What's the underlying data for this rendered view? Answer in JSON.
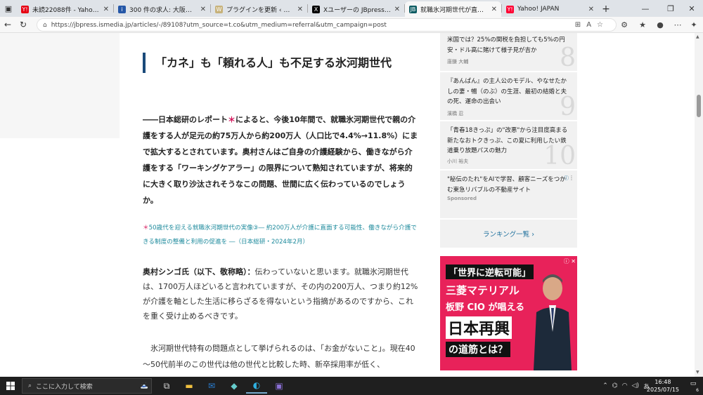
{
  "tabs": [
    {
      "title": "未読22088件 - Yahoo!メール",
      "favicon": "Y!",
      "fav_color": "#e60012",
      "active": false
    },
    {
      "title": "300 件の求人: 大阪府 大阪市",
      "favicon": "i",
      "fav_color": "#2557a7",
      "active": false
    },
    {
      "title": "プラグインを更新 ‹ よしてよせてのの",
      "favicon": "W",
      "fav_color": "#c7b27a",
      "active": false
    },
    {
      "title": "Xユーザーの JBpress（ジェイビー）",
      "favicon": "X",
      "fav_color": "#000000",
      "active": false
    },
    {
      "title": "就職氷河期世代が直面する介",
      "favicon": "JB",
      "fav_color": "#0d5c63",
      "active": true
    },
    {
      "title": "Yahoo! JAPAN",
      "favicon": "Y!",
      "fav_color": "#ff0033",
      "active": false
    }
  ],
  "address_bar": {
    "url": "https://jbpress.ismedia.jp/articles/-/89108?utm_source=t.co&utm_medium=referral&utm_campaign=post"
  },
  "article": {
    "heading": "「カネ」も「頼れる人」も不足する氷河期世代",
    "lead_pre": "――日本総研のレポート",
    "lead_mark": "＊",
    "lead_post": "によると、今後10年間で、就職氷河期世代で親の介護をする人が足元の約75万人から約200万人（人口比で4.4%→11.8%）にまで拡大するとされています。奥村さんはご自身の介護経験から、働きながら介護をする「ワーキングケアラー」の限界について熟知されていますが、将来的に大きく取り沙汰されそうなこの問題、世間に広く伝わっているのでしょうか。",
    "note_mark": "＊",
    "note_text": "50歳代を迎える就職氷河期世代の実像③― 約200万人が介護に直面する可能性、働きながら介護できる制度の整備と利用の促進を ―（日本総研・2024年2月）",
    "speaker": "奥村シンゴ氏（以下、敬称略）：",
    "answer": "伝わっていないと思います。就職氷河期世代は、1700万人ほどいると言われていますが、その内の200万人、つまり約12%が介護を軸とした生活に移らざるを得ないという指摘があるのですから、これを重く受け止めるべきです。",
    "paragraph2": "氷河期世代特有の問題点として挙げられるのは、「お金がないこと」。現在40～50代前半のこの世代は他の世代と比較した時、新卒採用率が低く、"
  },
  "sidebar": {
    "ranking": [
      {
        "title": "米国では？25%の関税を負担しても5%の円安・ドル高に賭けて様子見が吉か",
        "author": "唐鎌 大輔",
        "rank": "8"
      },
      {
        "title": "『あんぱん』の主人公のモデル、やなせたかしの妻・暢（のぶ）の生涯、最初の結婚と夫の死、運命の出会い",
        "author": "濱橋 忍",
        "rank": "9"
      },
      {
        "title": "「青春18きっぷ」の\"改悪\"から注目度高まる新たなおトクきっぷ、この夏に利用したい鉄道乗り放題パスの魅力",
        "author": "小川 裕夫",
        "rank": "10"
      }
    ],
    "sponsored_title": "\"秘伝のたれ\"をAIで学習、顧客ニーズをつかむ東急リバブルの不動産サイト",
    "sponsored_label": "Sponsored",
    "ranking_button": "ランキング一覧 ›",
    "ad": {
      "line1": "「世界に逆転可能」",
      "line2": "三菱マテリアル",
      "line3": "板野 CIO が唱える",
      "line4": "日本再興",
      "line5": "の道筋とは？"
    }
  },
  "taskbar": {
    "search_placeholder": "ここに入力して検索",
    "time": "16:48",
    "date": "2025/07/15",
    "ime": "あ",
    "notifications": "6"
  }
}
